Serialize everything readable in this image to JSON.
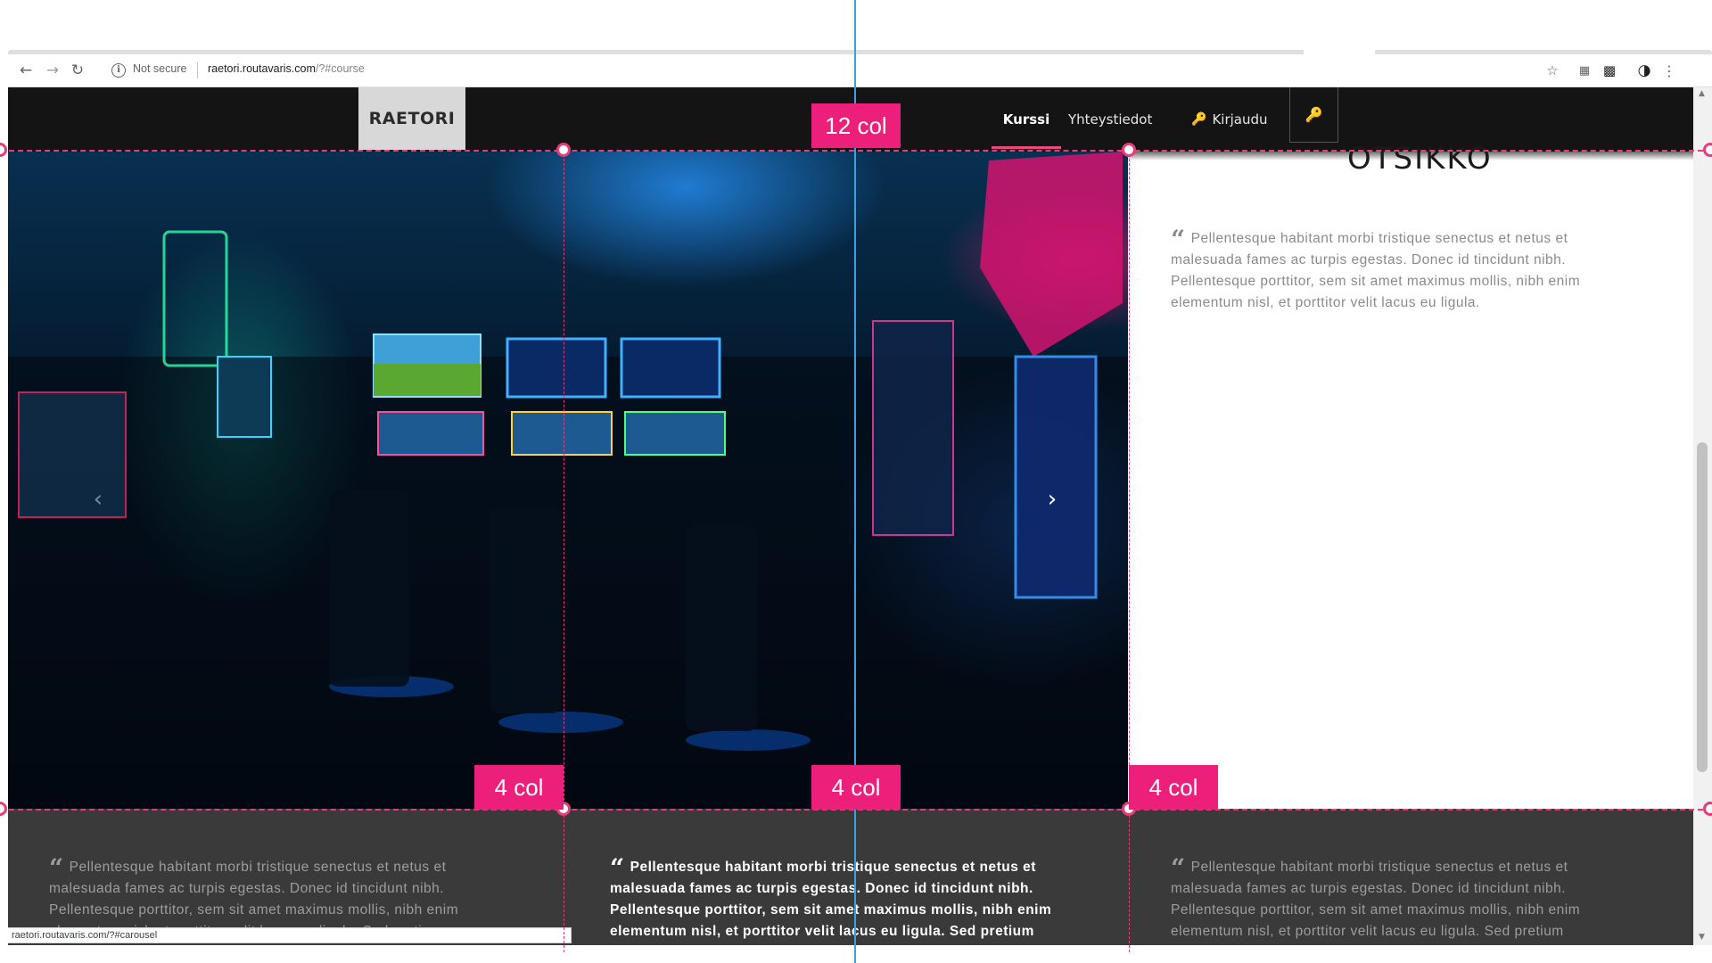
{
  "browser": {
    "not_secure_label": "Not secure",
    "url_host": "raetori.routavaris.com",
    "url_path": "/?#course",
    "status_url": "raetori.routavaris.com/?#carousel"
  },
  "nav": {
    "logo": "RAETORI",
    "items": [
      {
        "label": "Kurssi"
      },
      {
        "label": "Yhteystiedot"
      },
      {
        "label": "Kirjaudu"
      }
    ]
  },
  "side": {
    "title": "OTSIKKO",
    "text": "Pellentesque habitant morbi tristique senectus et netus et malesuada fames ac turpis egestas. Donec id tincidunt nibh. Pellentesque porttitor, sem sit amet maximus mollis, nibh enim elementum nisl, et porttitor velit lacus eu ligula."
  },
  "footer": {
    "columns": [
      {
        "text": "Pellentesque habitant morbi tristique senectus et netus et malesuada fames ac turpis egestas. Donec id tincidunt nibh. Pellentesque porttitor, sem sit amet maximus mollis, nibh enim elementum nisl, et porttitor velit lacus eu ligula. Sed pretium"
      },
      {
        "text": "Pellentesque habitant morbi tristique senectus et netus et malesuada fames ac turpis egestas. Donec id tincidunt nibh. Pellentesque porttitor, sem sit amet maximus mollis, nibh enim elementum nisl, et porttitor velit lacus eu ligula. Sed pretium"
      },
      {
        "text": "Pellentesque habitant morbi tristique senectus et netus et malesuada fames ac turpis egestas. Donec id tincidunt nibh. Pellentesque porttitor, sem sit amet maximus mollis, nibh enim elementum nisl, et porttitor velit lacus eu ligula. Sed pretium"
      }
    ]
  },
  "annotations": {
    "top_label": "12 col",
    "bottom_labels": [
      "4 col",
      "4 col",
      "4 col"
    ]
  },
  "colors": {
    "accent_pink": "#ec1f7b",
    "guide_blue": "#3aa0e0",
    "navbar_bg": "#141414",
    "footer_bg": "#3a3a3a"
  }
}
